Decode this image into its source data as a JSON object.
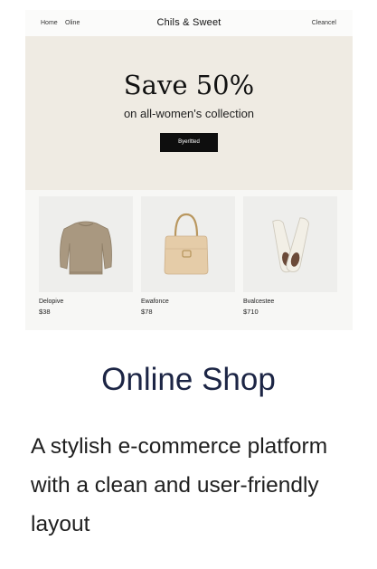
{
  "nav": {
    "home_label": "Home",
    "online_label": "Oline",
    "brand": "Chils & Sweet",
    "clearance_label": "Cleancel"
  },
  "hero": {
    "title": "Save 50%",
    "subtitle": "on all-women's collection",
    "button_label": "Byerltted"
  },
  "products": [
    {
      "name": "Delopive",
      "price": "$38",
      "icon": "sweater-icon"
    },
    {
      "name": "Ewafonce",
      "price": "$78",
      "icon": "handbag-icon"
    },
    {
      "name": "Bvalcestee",
      "price": "$710",
      "icon": "sneakers-icon"
    }
  ],
  "info": {
    "title": "Online Shop",
    "description": "A stylish e-commerce platform with a clean and user-friendly layout"
  },
  "colors": {
    "hero_background": "#efebe3",
    "button_background": "#0e0e0e",
    "title_color": "#1c2545"
  }
}
